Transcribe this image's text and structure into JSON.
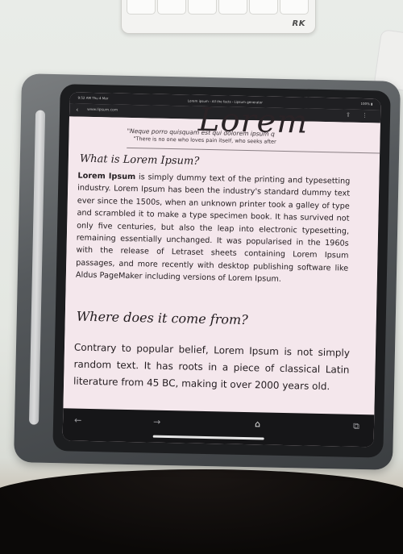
{
  "desk": {
    "keyboard_brand": "RK"
  },
  "status_bar": {
    "time": "9:52 AM  Thu 4 Mar",
    "title": "Lorem ipsum - All the facts - Lipsum generator",
    "right": "100% ▮"
  },
  "browser": {
    "url": "www.lipsum.com",
    "back_icon": "chevron-left",
    "toolbar": {
      "back_icon": "arrow-left",
      "forward_icon": "arrow-right",
      "home_icon": "home",
      "tabs_icon": "tabs"
    }
  },
  "page": {
    "site_heading": "Lorem",
    "quote": "\"Neque porro quisquam est qui dolorem ipsum q",
    "subquote": "\"There is no one who loves pain itself, who seeks after",
    "section1_title": "What is Lorem Ipsum?",
    "section1_bold": "Lorem Ipsum",
    "section1_text": " is simply dummy text of the printing and typesetting industry. Lorem Ipsum has been the industry's standard dummy text ever since the 1500s, when an unknown printer took a galley of type and scrambled it to make a type specimen book. It has survived not only five centuries, but also the leap into electronic typesetting, remaining essentially unchanged. It was popularised in the 1960s with the release of Letraset sheets containing Lorem Ipsum passages, and more recently with desktop publishing software like Aldus PageMaker including versions of Lorem Ipsum.",
    "section2_title": "Where does it come from?",
    "section2_text": "Contrary to popular belief, Lorem Ipsum is not simply random text. It has roots in a piece of classical Latin literature from 45 BC, making it over 2000 years old."
  }
}
